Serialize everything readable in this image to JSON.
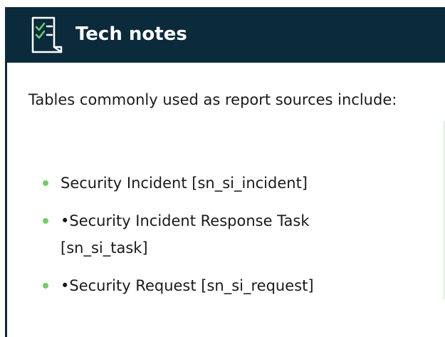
{
  "header": {
    "title": "Tech notes",
    "icon": "checklist-document-icon"
  },
  "content": {
    "intro": "Tables commonly used as report sources include:",
    "items": [
      {
        "label": "Security Incident [sn_si_incident]"
      },
      {
        "label": "•Security Incident Response Task [sn_si_task]"
      },
      {
        "label": "•Security Request [sn_si_request]"
      }
    ]
  },
  "colors": {
    "header_background": "#0b2b3c",
    "accent": "#6fcf6a",
    "text": "#1a1a1a"
  }
}
